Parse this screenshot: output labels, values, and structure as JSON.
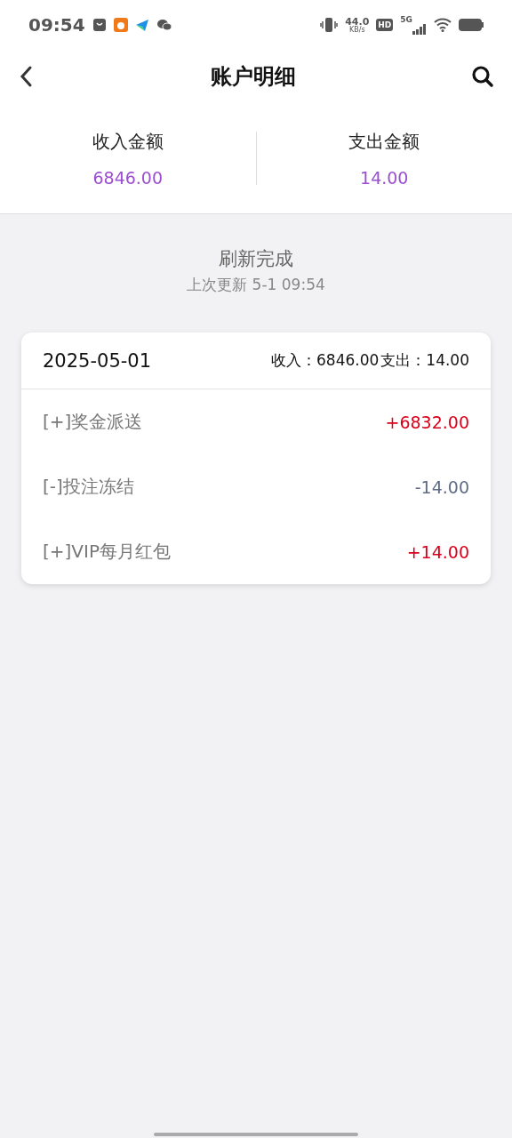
{
  "status_bar": {
    "time": "09:54",
    "speed_value": "44.0",
    "speed_unit": "KB/s",
    "hd": "HD",
    "network": "5G"
  },
  "header": {
    "title": "账户明细"
  },
  "summary": [
    {
      "label": "收入金额",
      "value": "6846.00"
    },
    {
      "label": "支出金额",
      "value": "14.00"
    }
  ],
  "refresh": {
    "title": "刷新完成",
    "subtitle": "上次更新 5-1 09:54"
  },
  "day_card": {
    "date": "2025-05-01",
    "income": "收入：6846.00",
    "expense": "支出：14.00",
    "items": [
      {
        "kind": "income",
        "label": "[+]奖金派送",
        "amount": "+6832.00"
      },
      {
        "kind": "expense",
        "label": "[-]投注冻结",
        "amount": "-14.00"
      },
      {
        "kind": "income",
        "label": "[+]VIP每月红包",
        "amount": "+14.00"
      }
    ]
  }
}
